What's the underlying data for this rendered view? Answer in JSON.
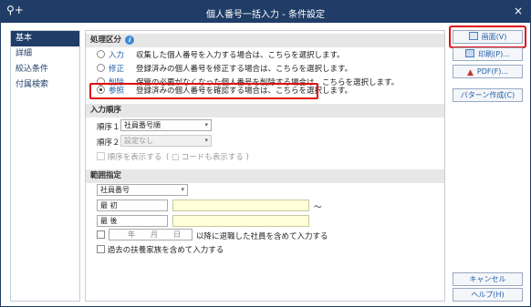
{
  "window": {
    "title": "個人番号一括入力 - 条件設定",
    "close": "×",
    "app_icon": "person-add-icon"
  },
  "sidebar": {
    "items": [
      "基本",
      "詳細",
      "絞込条件",
      "付属検索"
    ]
  },
  "process": {
    "header": "処理区分",
    "info_icon": "i",
    "options": [
      {
        "label": "入力",
        "desc": "収集した個人番号を入力する場合は、こちらを選択します。",
        "selected": false
      },
      {
        "label": "修正",
        "desc": "登録済みの個人番号を修正する場合は、こちらを選択します。",
        "selected": false
      },
      {
        "label": "削除",
        "desc": "保管の必要がなくなった個人番号を削除する場合は、こちらを選択します。",
        "selected": false
      },
      {
        "label": "参照",
        "desc": "登録済みの個人番号を確認する場合は、こちらを選択します。",
        "selected": true
      }
    ]
  },
  "order": {
    "header": "入力順序",
    "order1_label": "順序１",
    "order1_value": "社員番号順",
    "order2_label": "順序２",
    "order2_value": "設定なし",
    "show_order": "順序を表示する",
    "show_code": "( □ コードも表示する )"
  },
  "range": {
    "header": "範囲指定",
    "field": "社員番号",
    "first_label": "最 初",
    "last_label": "最 後",
    "tilde": "〜",
    "date_year": "年",
    "date_month": "月",
    "date_day": "日",
    "date_suffix": "以降に退職した社員を含めて入力する",
    "past_dependents": "過去の扶養家族を含めて入力する"
  },
  "buttons": {
    "screen": "画面(V)",
    "print": "印刷(P)...",
    "pdf": "PDF(F)...",
    "pattern": "パターン作成(C)",
    "cancel": "キャンセル",
    "help": "ヘルプ(H)"
  },
  "colors": {
    "titlebar": "#1f3d67",
    "accent": "#1e5fa8",
    "highlight": "#e01010",
    "yellow_input": "#ffffd8"
  }
}
